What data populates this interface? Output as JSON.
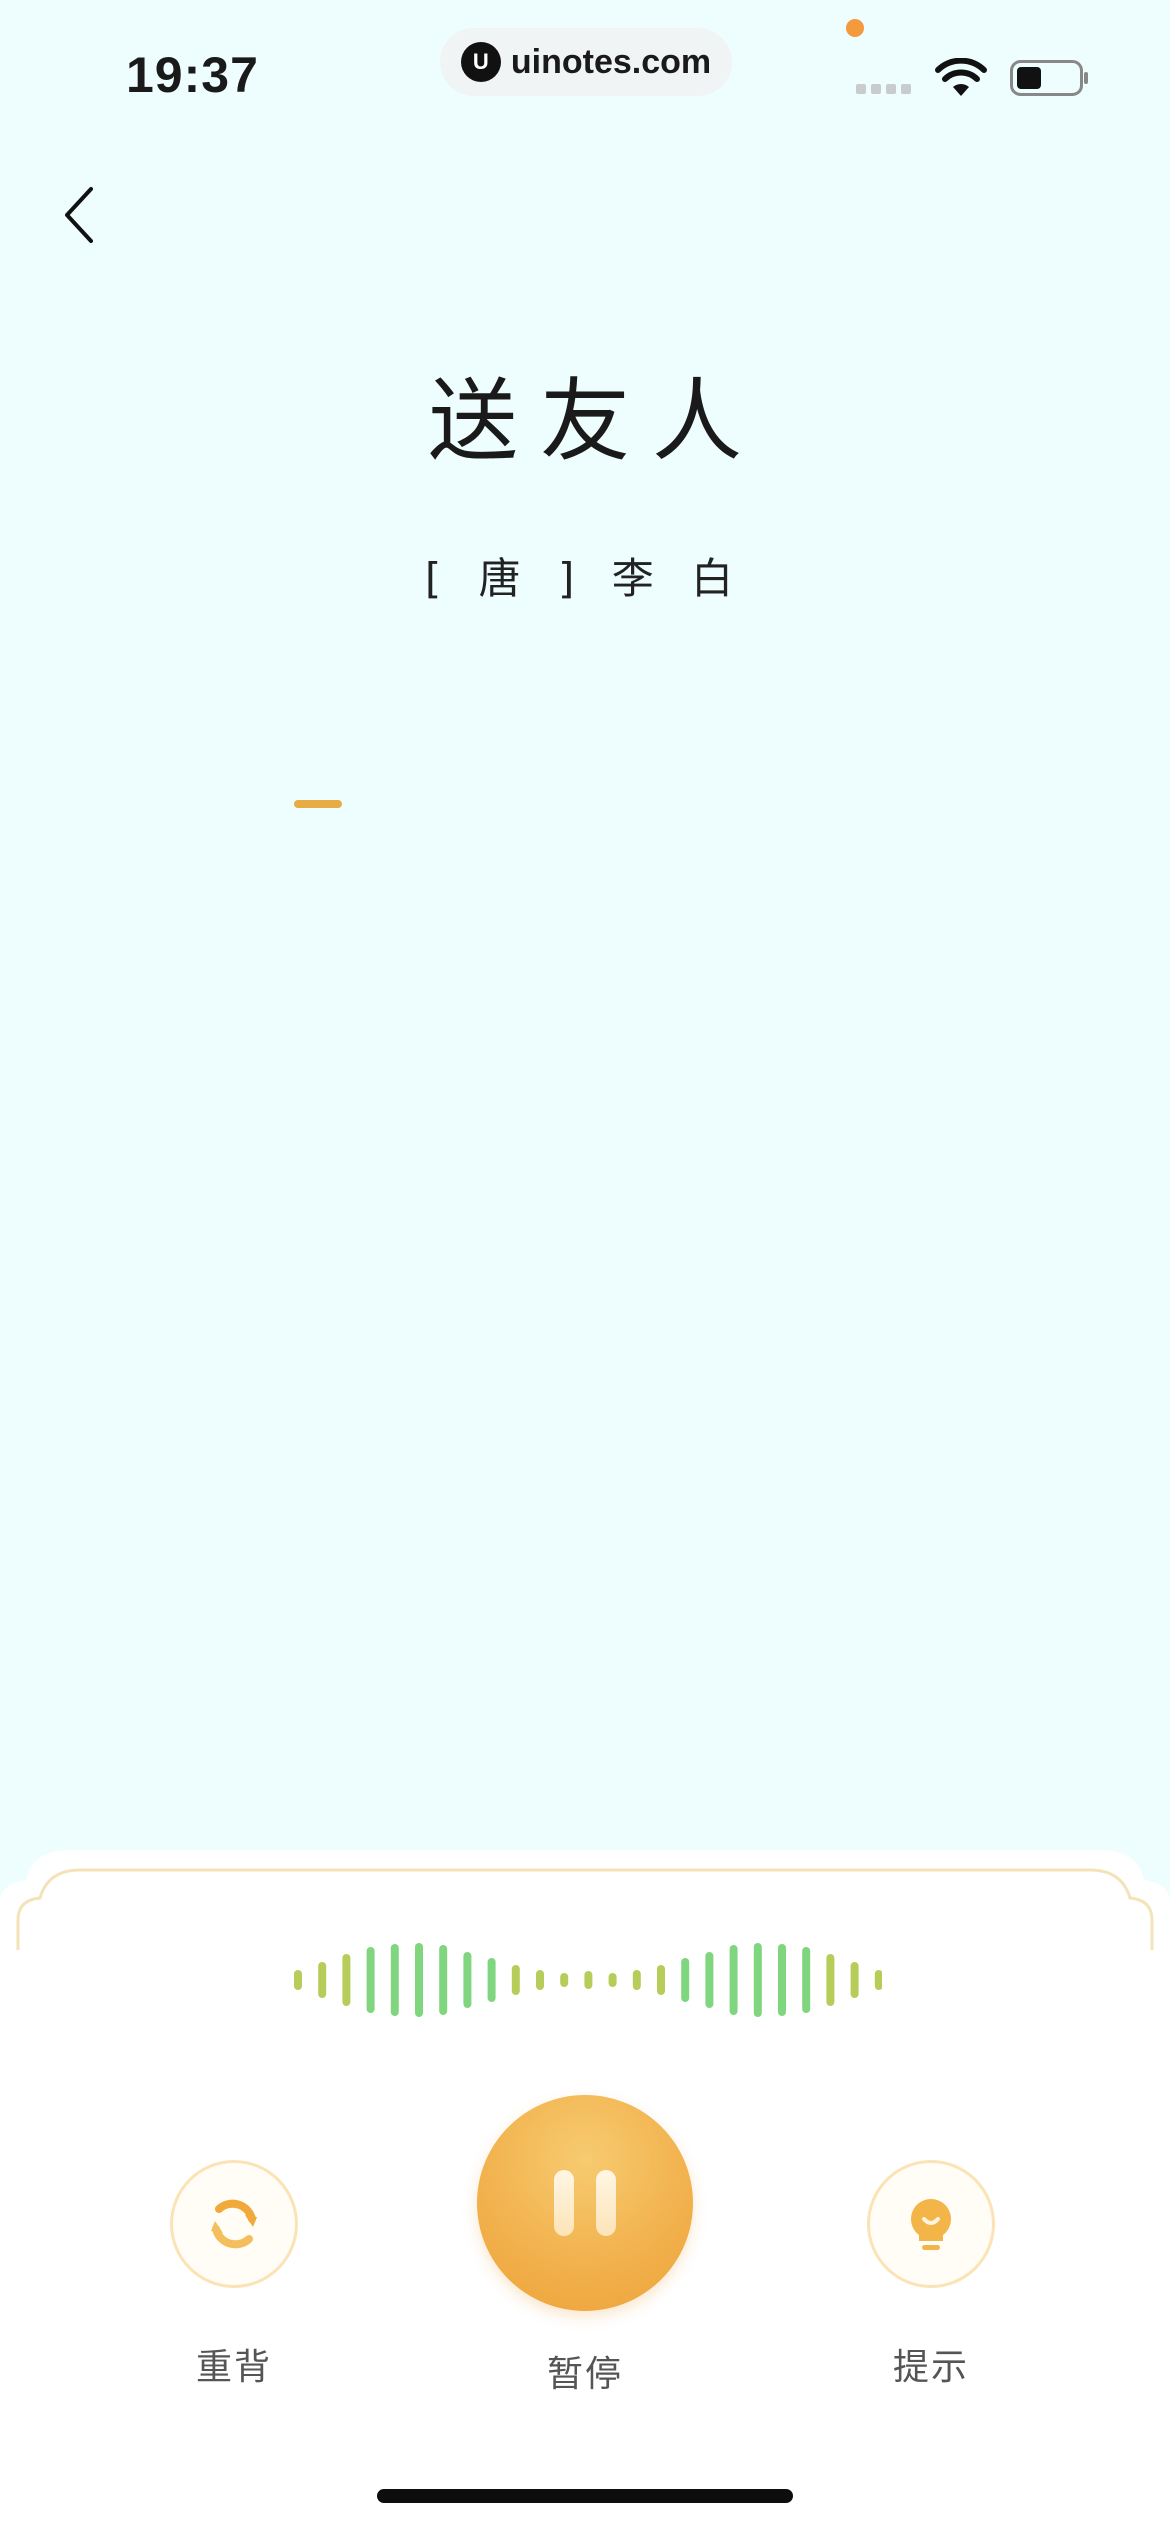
{
  "status_bar": {
    "time": "19:37",
    "url": "uinotes.com",
    "url_logo": "U"
  },
  "poem": {
    "title": "送友人",
    "author": "[ 唐 ] 李 白"
  },
  "controls": {
    "restart_label": "重背",
    "pause_label": "暂停",
    "hint_label": "提示"
  },
  "colors": {
    "background": "#eefdfd",
    "accent_orange": "#f2b24e",
    "cursor_orange": "#e8ac45",
    "wave_green": "#7fd67f",
    "wave_yellow_green": "#b7cd5a",
    "panel_border": "#f4e3b9"
  },
  "icons": {
    "back": "chevron-left-icon",
    "restart": "refresh-icon",
    "pause": "pause-icon",
    "hint": "lightbulb-icon",
    "wifi": "wifi-icon",
    "battery": "battery-icon"
  }
}
